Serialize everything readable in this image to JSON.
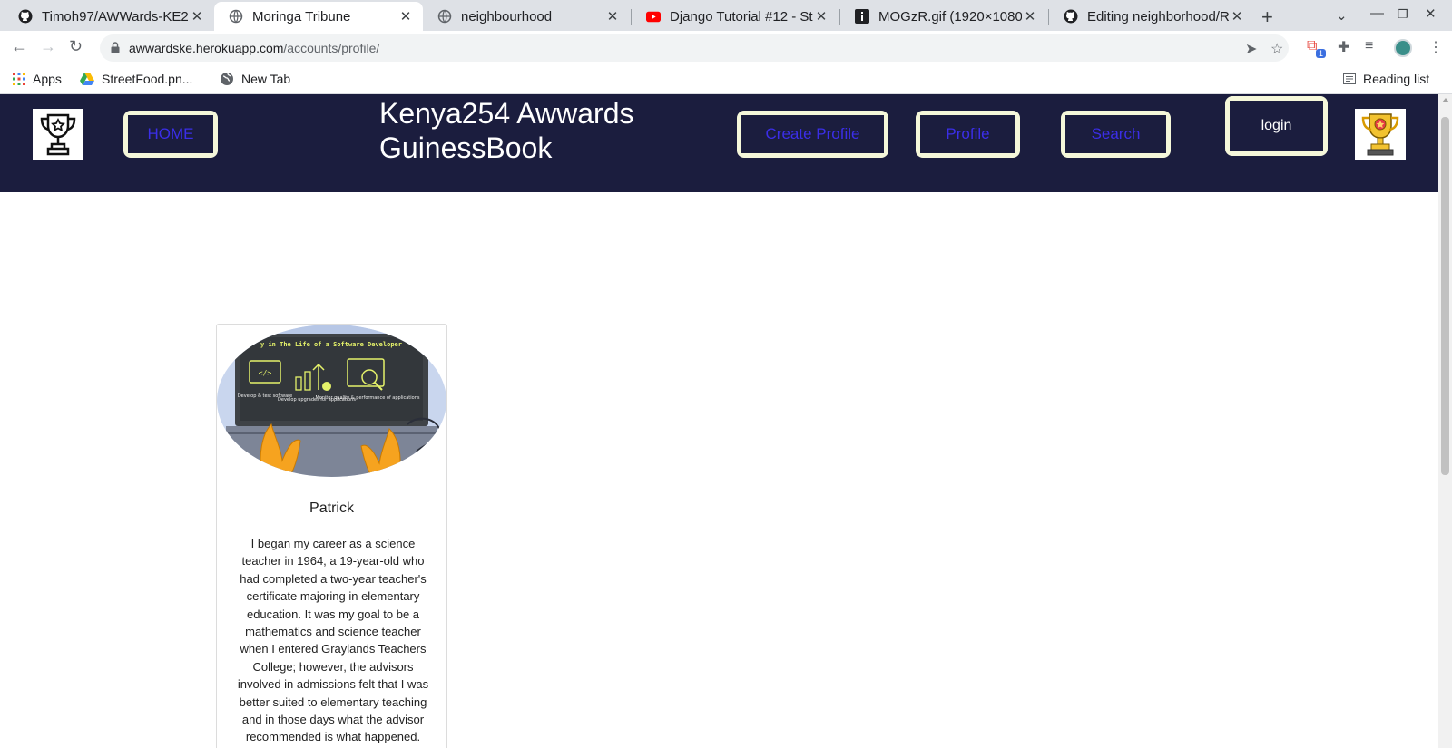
{
  "browser": {
    "tabs": [
      {
        "title": "Timoh97/AWWards-KE2",
        "icon": "github-icon",
        "active": false
      },
      {
        "title": "Moringa Tribune",
        "icon": "globe-icon",
        "active": true
      },
      {
        "title": "neighbourhood",
        "icon": "globe-icon",
        "active": false
      },
      {
        "title": "Django Tutorial #12 - St",
        "icon": "youtube-icon",
        "active": false
      },
      {
        "title": "MOGzR.gif (1920×1080)",
        "icon": "info-icon",
        "active": false
      },
      {
        "title": "Editing neighborhood/R",
        "icon": "github-icon",
        "active": false
      }
    ],
    "address": {
      "host": "awwardske.herokuapp.com",
      "path": "/accounts/profile/"
    },
    "extension_badge": "1",
    "bookmarks": [
      {
        "label": "Apps",
        "icon": "apps-grid-icon"
      },
      {
        "label": "StreetFood.pn...",
        "icon": "drive-icon"
      },
      {
        "label": "New Tab",
        "icon": "globe-icon"
      }
    ],
    "reading_list": "Reading list"
  },
  "site": {
    "brand": "Kenya254 Awwards GuinessBook",
    "nav": {
      "home": "HOME",
      "create_profile": "Create Profile",
      "profile": "Profile",
      "search": "Search",
      "login": "login"
    },
    "colors": {
      "nav_bg": "#1b1d3e",
      "button_border": "#f5f7da",
      "link": "#3b2ee8"
    }
  },
  "profile": {
    "image_caption": "y in The Life of a Software Developer",
    "image_steps": [
      "Develop & test software",
      "Develop upgrades for applications",
      "Monitor quality & performance of applications"
    ],
    "name": "Patrick",
    "bio": "I began my career as a science teacher in 1964, a 19-year-old who had completed a two-year teacher's certificate majoring in elementary education. It was my goal to be a mathematics and science teacher when I entered Graylands Teachers College; however, the advisors involved in admissions felt that I was better suited to elementary teaching and in those days what the advisor recommended is what happened."
  }
}
